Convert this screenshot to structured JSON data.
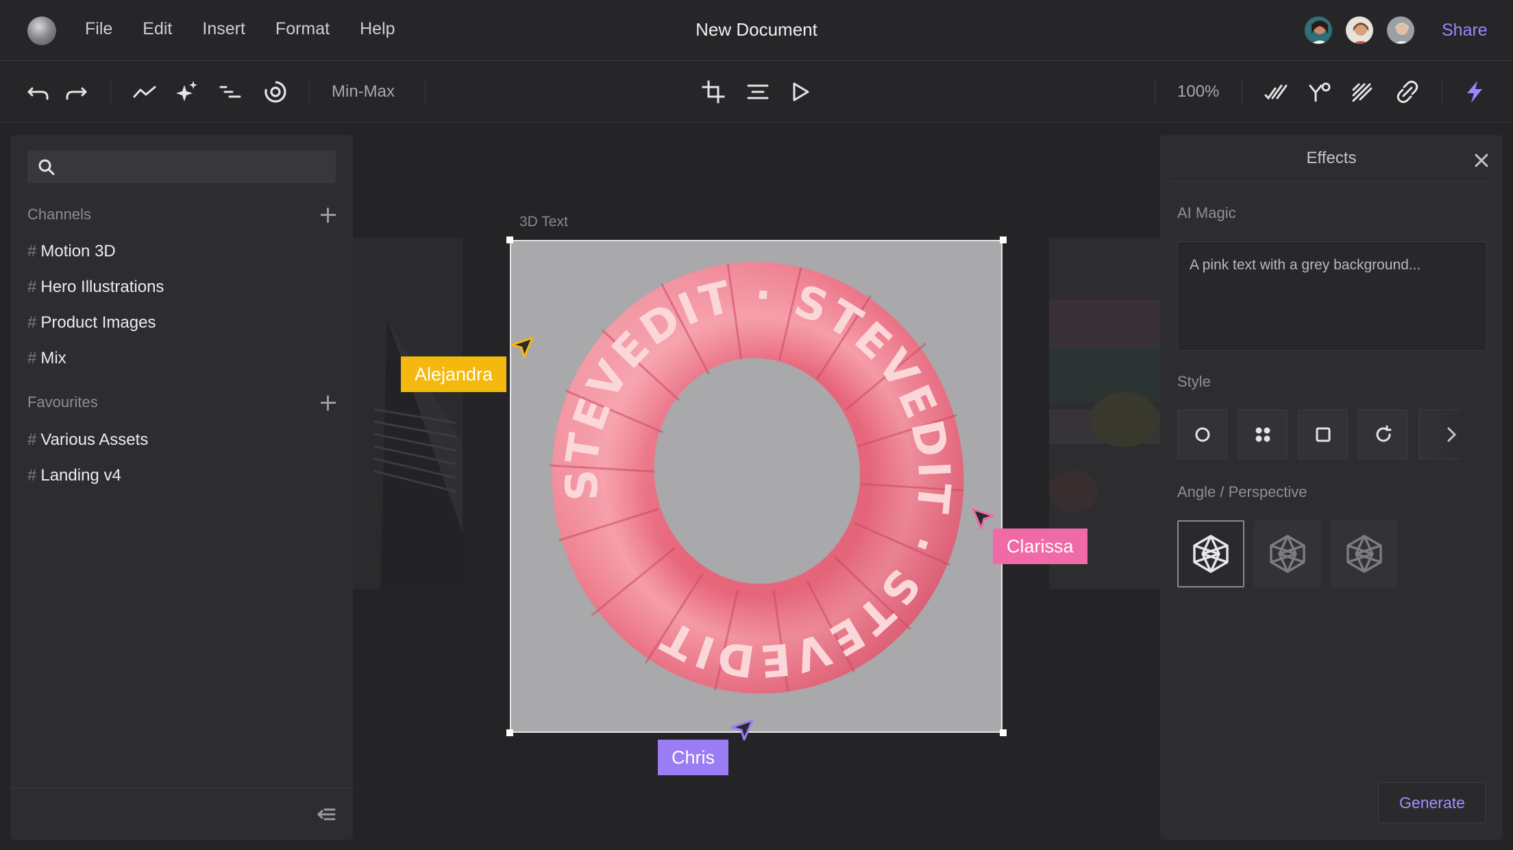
{
  "app": {
    "title": "New Document"
  },
  "menu": {
    "items": [
      "File",
      "Edit",
      "Insert",
      "Format",
      "Help"
    ]
  },
  "header": {
    "share_label": "Share",
    "collaborator_avatars": 3
  },
  "toolbar": {
    "mode_label": "Min-Max",
    "zoom": "100%"
  },
  "search": {
    "placeholder": ""
  },
  "sidebar": {
    "channels_heading": "Channels",
    "channels": [
      {
        "label": "Motion 3D"
      },
      {
        "label": "Hero Illustrations"
      },
      {
        "label": "Product Images"
      },
      {
        "label": "Mix"
      }
    ],
    "favourites_heading": "Favourites",
    "favourites": [
      {
        "label": "Various Assets"
      },
      {
        "label": "Landing v4"
      }
    ],
    "hash": "#"
  },
  "canvas": {
    "artboard_label": "3D Text",
    "artwork_text": "STEVEDIT",
    "cursors": [
      {
        "name": "Alejandra",
        "color": "#f5b80f"
      },
      {
        "name": "Clarissa",
        "color": "#f06aa8"
      },
      {
        "name": "Chris",
        "color": "#9a7cf4"
      }
    ]
  },
  "effects": {
    "title": "Effects",
    "ai_magic_label": "AI Magic",
    "prompt_placeholder": "A pink text with a grey background...",
    "style_label": "Style",
    "angle_label": "Angle / Perspective",
    "generate_label": "Generate"
  },
  "colors": {
    "accent": "#9d85ff",
    "panel": "#2d2d30",
    "background": "#242426",
    "artwork_pink": "#f08a98"
  }
}
